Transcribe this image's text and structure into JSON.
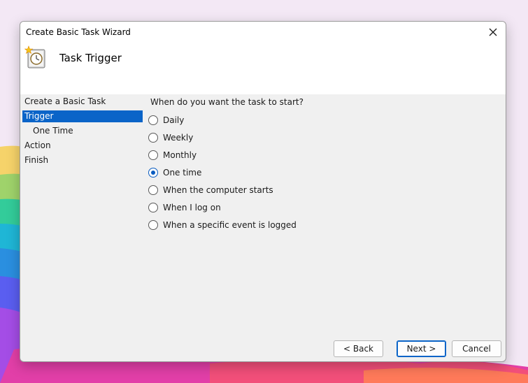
{
  "window": {
    "title": "Create Basic Task Wizard",
    "heading": "Task Trigger"
  },
  "icons": {
    "close": "close-icon",
    "wizard": "task-scheduler-clock-icon"
  },
  "nav": {
    "items": [
      {
        "label": "Create a Basic Task",
        "selected": false
      },
      {
        "label": "Trigger",
        "selected": true
      },
      {
        "label": "One Time",
        "selected": false
      },
      {
        "label": "Action",
        "selected": false
      },
      {
        "label": "Finish",
        "selected": false
      }
    ]
  },
  "main": {
    "question": "When do you want the task to start?",
    "options": [
      {
        "label": "Daily",
        "checked": false
      },
      {
        "label": "Weekly",
        "checked": false
      },
      {
        "label": "Monthly",
        "checked": false
      },
      {
        "label": "One time",
        "checked": true
      },
      {
        "label": "When the computer starts",
        "checked": false
      },
      {
        "label": "When I log on",
        "checked": false
      },
      {
        "label": "When a specific event is logged",
        "checked": false
      }
    ]
  },
  "buttons": {
    "back": "< Back",
    "next": "Next >",
    "cancel": "Cancel"
  },
  "colors": {
    "accent": "#0a64c8",
    "dialog_bg": "#f0f0f0",
    "header_bg": "#ffffff"
  }
}
